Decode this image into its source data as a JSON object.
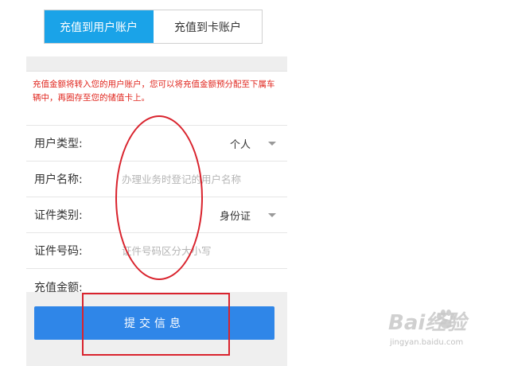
{
  "tabs": [
    {
      "label": "充值到用户账户",
      "active": true
    },
    {
      "label": "充值到卡账户",
      "active": false
    }
  ],
  "notice": "充值金额将转入您的用户账户，您可以将充值金额预分配至下属车辆中，再圈存至您的储值卡上。",
  "form": {
    "user_type": {
      "label": "用户类型:",
      "value": "个人"
    },
    "user_name": {
      "label": "用户名称:",
      "placeholder": "办理业务时登记的用户名称"
    },
    "id_type": {
      "label": "证件类别:",
      "value": "身份证"
    },
    "id_number": {
      "label": "证件号码:",
      "placeholder": "证件号码区分大小写"
    },
    "amount": {
      "label": "充值金额:"
    }
  },
  "submit_label": "提交信息",
  "watermark": {
    "logo": "Bai经验",
    "url": "jingyan.baidu.com"
  },
  "colors": {
    "accent": "#1aa3e8",
    "button": "#2f86e8",
    "notice": "#e0261e",
    "annotation": "#d9232d"
  }
}
